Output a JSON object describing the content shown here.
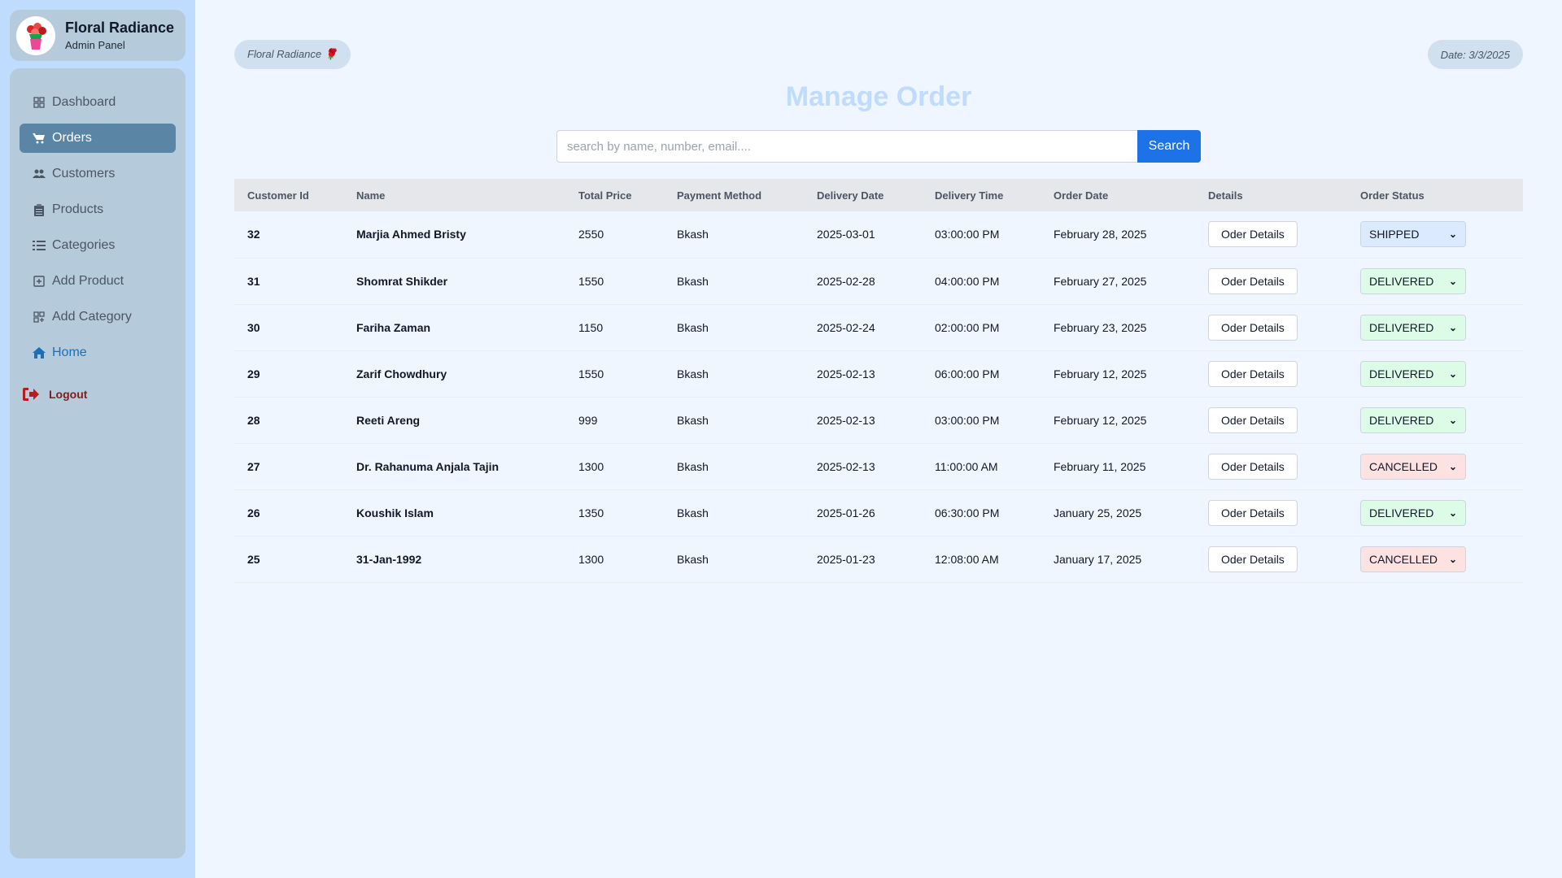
{
  "sidebar": {
    "brand_title": "Floral Radiance",
    "brand_subtitle": "Admin Panel",
    "items": [
      {
        "label": "Dashboard",
        "icon": "grid-icon"
      },
      {
        "label": "Orders",
        "icon": "cart-icon",
        "active": true
      },
      {
        "label": "Customers",
        "icon": "users-icon"
      },
      {
        "label": "Products",
        "icon": "clipboard-icon"
      },
      {
        "label": "Categories",
        "icon": "list-icon"
      },
      {
        "label": "Add Product",
        "icon": "plus-square-icon"
      },
      {
        "label": "Add Category",
        "icon": "grid-plus-icon"
      },
      {
        "label": "Home",
        "icon": "home-icon"
      }
    ],
    "logout_label": "Logout"
  },
  "header": {
    "brand_pill": "Floral Radiance 🌹",
    "date_pill": "Date: 3/3/2025",
    "title": "Manage Order"
  },
  "search": {
    "placeholder": "search by name, number, email....",
    "button_label": "Search"
  },
  "table": {
    "columns": [
      "Customer Id",
      "Name",
      "Total Price",
      "Payment Method",
      "Delivery Date",
      "Delivery Time",
      "Order Date",
      "Details",
      "Order Status"
    ],
    "details_label": "Oder Details",
    "rows": [
      {
        "id": "32",
        "name": "Marjia Ahmed Bristy",
        "price": "2550",
        "payment": "Bkash",
        "delivery_date": "2025-03-01",
        "delivery_time": "03:00:00 PM",
        "order_date": "February 28, 2025",
        "status": "SHIPPED"
      },
      {
        "id": "31",
        "name": "Shomrat Shikder",
        "price": "1550",
        "payment": "Bkash",
        "delivery_date": "2025-02-28",
        "delivery_time": "04:00:00 PM",
        "order_date": "February 27, 2025",
        "status": "DELIVERED"
      },
      {
        "id": "30",
        "name": "Fariha Zaman",
        "price": "1150",
        "payment": "Bkash",
        "delivery_date": "2025-02-24",
        "delivery_time": "02:00:00 PM",
        "order_date": "February 23, 2025",
        "status": "DELIVERED"
      },
      {
        "id": "29",
        "name": "Zarif Chowdhury",
        "price": "1550",
        "payment": "Bkash",
        "delivery_date": "2025-02-13",
        "delivery_time": "06:00:00 PM",
        "order_date": "February 12, 2025",
        "status": "DELIVERED"
      },
      {
        "id": "28",
        "name": "Reeti Areng",
        "price": "999",
        "payment": "Bkash",
        "delivery_date": "2025-02-13",
        "delivery_time": "03:00:00 PM",
        "order_date": "February 12, 2025",
        "status": "DELIVERED"
      },
      {
        "id": "27",
        "name": "Dr. Rahanuma Anjala Tajin",
        "price": "1300",
        "payment": "Bkash",
        "delivery_date": "2025-02-13",
        "delivery_time": "11:00:00 AM",
        "order_date": "February 11, 2025",
        "status": "CANCELLED"
      },
      {
        "id": "26",
        "name": "Koushik Islam",
        "price": "1350",
        "payment": "Bkash",
        "delivery_date": "2025-01-26",
        "delivery_time": "06:30:00 PM",
        "order_date": "January 25, 2025",
        "status": "DELIVERED"
      },
      {
        "id": "25",
        "name": "31-Jan-1992",
        "price": "1300",
        "payment": "Bkash",
        "delivery_date": "2025-01-23",
        "delivery_time": "12:08:00 AM",
        "order_date": "January 17, 2025",
        "status": "CANCELLED"
      }
    ]
  },
  "colors": {
    "sidebar_bg": "#bfdbfe",
    "active_nav": "#5b85a5",
    "accent": "#1d72e8",
    "status_shipped": "#dbeafe",
    "status_delivered": "#dcfce7",
    "status_cancelled": "#fee2e2"
  }
}
